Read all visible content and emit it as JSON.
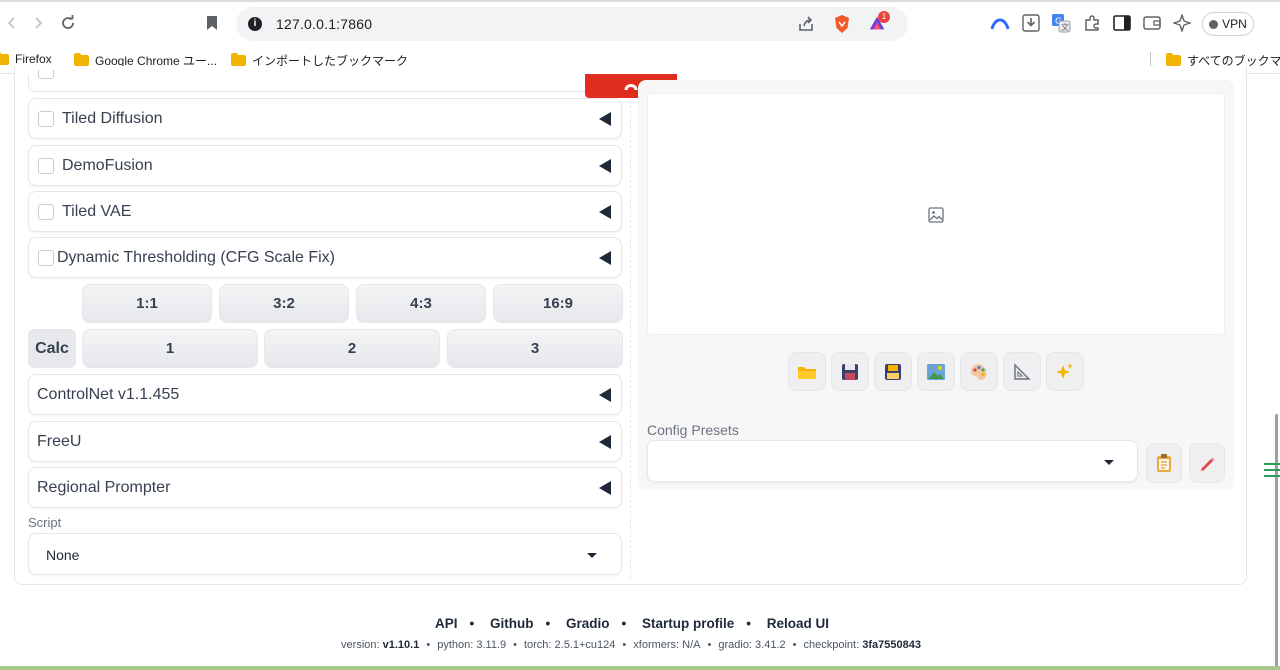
{
  "browser": {
    "url": "127.0.0.1:7860",
    "vpn_label": "VPN",
    "brave_rewards_badge": "1",
    "bookmarks": [
      "Firefox",
      "Google Chrome ユー...",
      "インポートしたブックマーク"
    ],
    "all_bookmarks": "すべてのブックマーク"
  },
  "accordions": [
    "Tiled Diffusion",
    "DemoFusion",
    "Tiled VAE",
    "Dynamic Thresholding (CFG Scale Fix)"
  ],
  "aspect_buttons": [
    "1:1",
    "3:2",
    "4:3",
    "16:9"
  ],
  "calc_label": "Calc",
  "calc_buttons": [
    "1",
    "2",
    "3"
  ],
  "extensions": [
    "ControlNet v1.1.455",
    "FreeU",
    "Regional Prompter"
  ],
  "script": {
    "label": "Script",
    "value": "None"
  },
  "config_presets": {
    "label": "Config Presets",
    "value": ""
  },
  "tool_icons": [
    "folder-icon",
    "save-icon",
    "zip-icon",
    "image-icon",
    "palette-icon",
    "ruler-icon",
    "sparkle-icon"
  ],
  "footer": {
    "links": [
      "API",
      "Github",
      "Gradio",
      "Startup profile",
      "Reload UI"
    ],
    "version": {
      "version_label": "version:",
      "version": "v1.10.1",
      "python": "python: 3.11.9",
      "torch": "torch: 2.5.1+cu124",
      "xformers": "xformers: N/A",
      "gradio": "gradio: 3.41.2",
      "checkpoint_label": "checkpoint:",
      "checkpoint": "3fa7550843"
    }
  },
  "colors": {
    "accent_red": "#e02d1f",
    "page_bg": "#ffffff",
    "panel_bg": "#f7f7f8"
  }
}
